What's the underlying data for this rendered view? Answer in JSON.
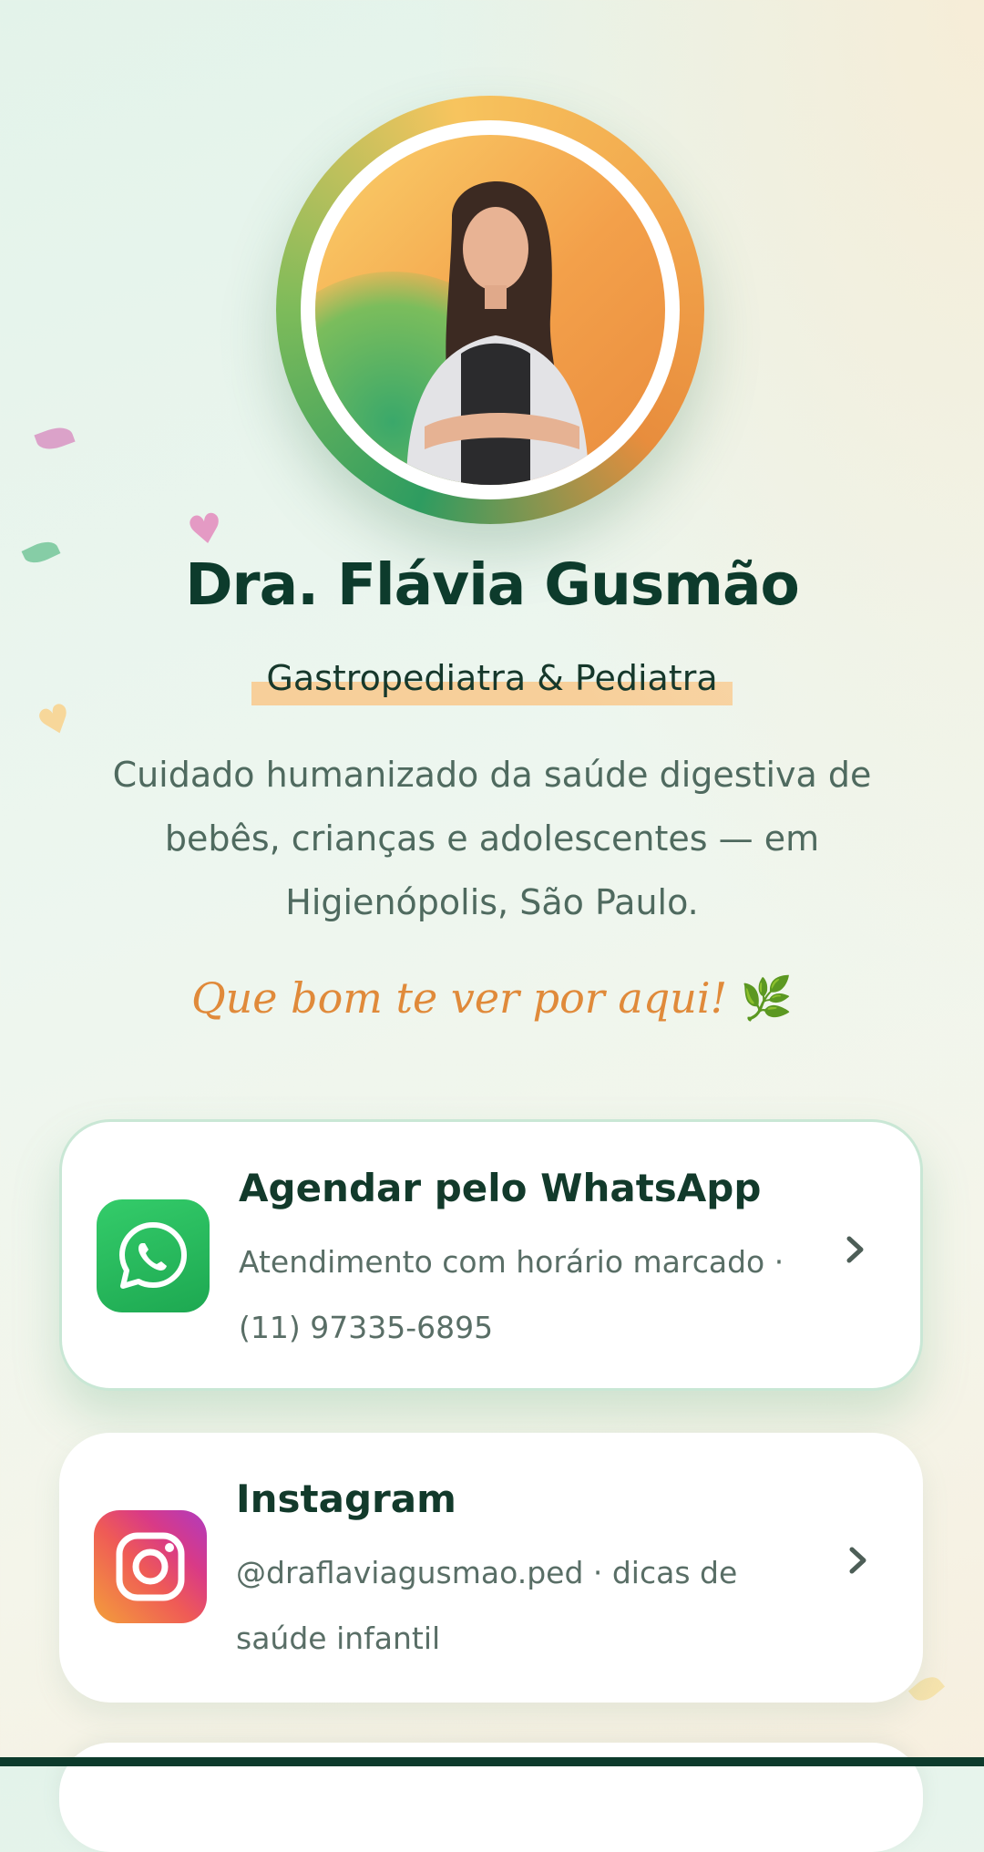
{
  "profile": {
    "name": "Dra. Flávia Gusmão",
    "specialty": "Gastropediatra & Pediatra",
    "description": "Cuidado humanizado da saúde digestiva de bebês, crianças e adolescentes — em Higienópolis, São Paulo.",
    "greeting": "Que bom te ver por aqui!",
    "greeting_emoji": "🌿",
    "photo_icon": "profile-photo"
  },
  "links": [
    {
      "title": "Agendar pelo WhatsApp",
      "subtitle": "Atendimento com horário marcado · (11) 97335-6895",
      "icon": "whatsapp-icon",
      "color": "#25C05A"
    },
    {
      "title": "Instagram",
      "subtitle": "@draflaviagusmao.ped · dicas de saúde infantil",
      "icon": "instagram-icon",
      "color": "#E1306C"
    }
  ],
  "decorations": {
    "heart_glyph": "♥"
  },
  "colors": {
    "primary_dark": "#0D3B2C",
    "accent_orange": "#E08A3A",
    "highlight": "#F7CF9A"
  }
}
